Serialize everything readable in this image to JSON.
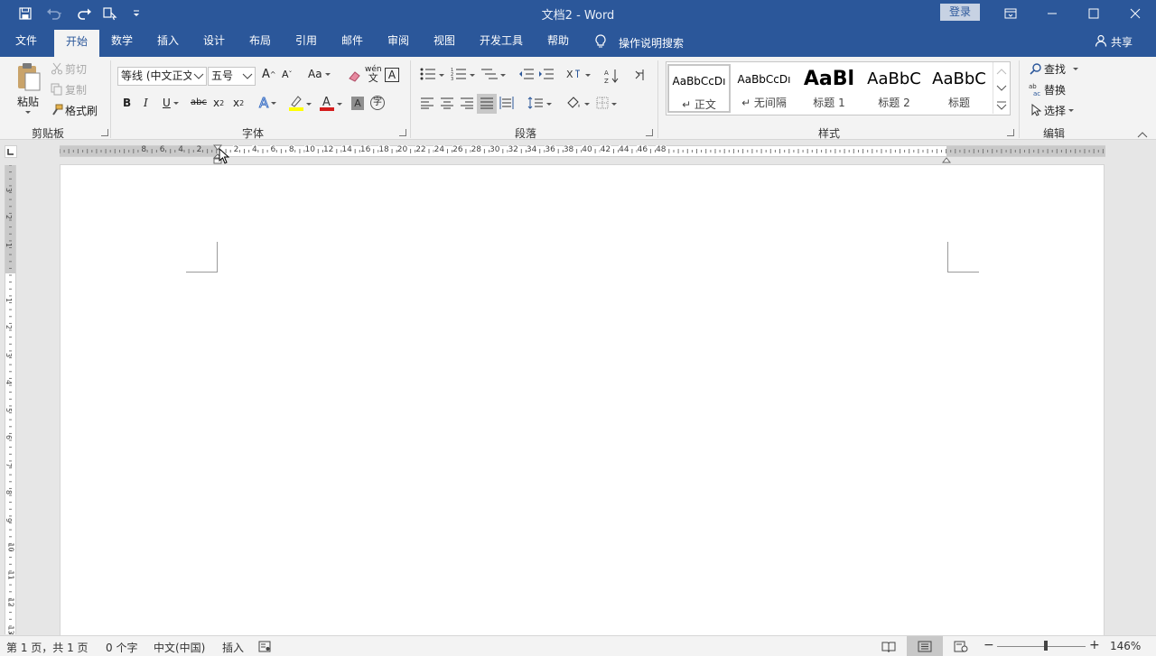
{
  "window": {
    "title": "文档2 - Word",
    "login_label": "登录",
    "controls": [
      "ribbon-display-icon",
      "minimize-icon",
      "maximize-icon",
      "close-icon"
    ]
  },
  "quick_access": [
    "save-icon",
    "undo-icon",
    "redo-icon",
    "touch-mode-icon",
    "customize-icon"
  ],
  "tabs": [
    {
      "label": "文件"
    },
    {
      "label": "开始",
      "active": true
    },
    {
      "label": "数学"
    },
    {
      "label": "插入"
    },
    {
      "label": "设计"
    },
    {
      "label": "布局"
    },
    {
      "label": "引用"
    },
    {
      "label": "邮件"
    },
    {
      "label": "审阅"
    },
    {
      "label": "视图"
    },
    {
      "label": "开发工具"
    },
    {
      "label": "帮助"
    }
  ],
  "tell_me": "操作说明搜索",
  "share": "共享",
  "clipboard": {
    "paste": "粘贴",
    "cut": "剪切",
    "copy": "复制",
    "format_painter": "格式刷",
    "group_label": "剪贴板"
  },
  "font": {
    "font_name": "等线 (中文正文",
    "font_size": "五号",
    "group_label": "字体",
    "phonetic": "wén",
    "change_case": "Aa"
  },
  "paragraph": {
    "group_label": "段落"
  },
  "styles": {
    "group_label": "样式",
    "items": [
      {
        "sample": "AaBbCcDı",
        "name": "↵ 正文",
        "selected": true
      },
      {
        "sample": "AaBbCcDı",
        "name": "↵ 无间隔"
      },
      {
        "sample": "AaBl",
        "name": "标题 1"
      },
      {
        "sample": "AaBbC",
        "name": "标题 2"
      },
      {
        "sample": "AaBbC",
        "name": "标题"
      }
    ]
  },
  "editing": {
    "find": "查找",
    "replace": "替换",
    "select": "选择",
    "group_label": "编辑"
  },
  "ruler": {
    "h_left_labels": [
      "8",
      "6",
      "4",
      "2"
    ],
    "h_right_labels": [
      "2",
      "4",
      "6",
      "8",
      "10",
      "12",
      "14",
      "16",
      "18",
      "20",
      "22",
      "24",
      "26",
      "28",
      "30",
      "32",
      "34",
      "36",
      "38",
      "40",
      "42",
      "44",
      "46",
      "48"
    ],
    "v_top_labels": [
      "3",
      "2",
      "1"
    ],
    "v_bottom_labels": [
      "1",
      "2",
      "3",
      "4",
      "5",
      "6",
      "7",
      "8",
      "9",
      "10",
      "11",
      "12",
      "13"
    ]
  },
  "status": {
    "page": "第 1 页，共 1 页",
    "words": "0 个字",
    "language": "中文(中国)",
    "mode": "插入",
    "zoom": "146%",
    "zoom_level": 0.55
  }
}
